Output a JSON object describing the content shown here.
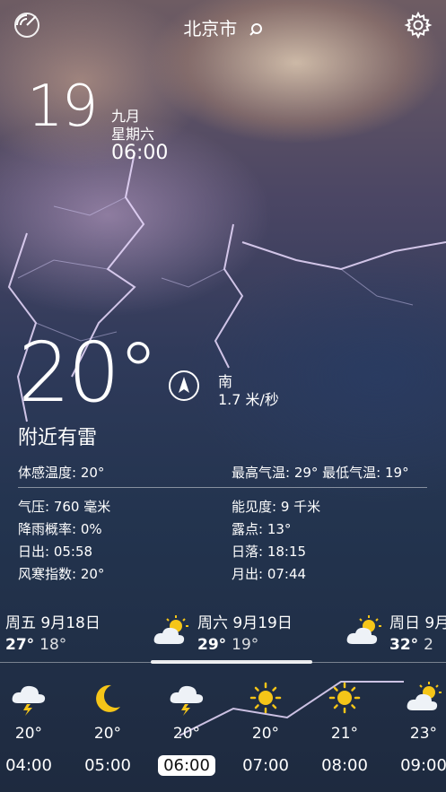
{
  "header": {
    "city": "北京市",
    "icons": {
      "left": "radar-icon",
      "search": "search-icon",
      "right": "gear-icon"
    }
  },
  "date": {
    "day": "19",
    "month": "九月",
    "weekday": "星期六",
    "time": "06:00"
  },
  "current": {
    "temperature": "20°",
    "condition": "附近有雷",
    "wind": {
      "direction": "南",
      "speed": "1.7 米/秒",
      "icon": "wind-direction-icon"
    }
  },
  "details": {
    "feels_like": "体感温度: 20°",
    "high_low": "最高气温: 29° 最低气温: 19°",
    "pressure": "气压:  760 毫米",
    "visibility": "能见度: 9 千米",
    "rain_chance": "降雨概率: 0%",
    "dew_point": "露点: 13°",
    "sunrise": "日出: 05:58",
    "sunset": "日落: 18:15",
    "wind_chill": "风寒指数: 20°",
    "moonrise": "月出: 07:44"
  },
  "daily": [
    {
      "name": "周五  9月18日",
      "high": "27°",
      "low": "18°",
      "icon": "none"
    },
    {
      "name": "周六  9月19日",
      "high": "29°",
      "low": "19°",
      "icon": "partly-cloudy-icon"
    },
    {
      "name": "周日  9月",
      "high": "32°",
      "low": "2",
      "icon": "partly-cloudy-icon"
    }
  ],
  "hourly": [
    {
      "temp": "20°",
      "time": "04:00",
      "icon": "thunder-cloud-icon",
      "selected": false
    },
    {
      "temp": "20°",
      "time": "05:00",
      "icon": "moon-icon",
      "selected": false
    },
    {
      "temp": "20°",
      "time": "06:00",
      "icon": "thunder-cloud-icon",
      "selected": true
    },
    {
      "temp": "20°",
      "time": "07:00",
      "icon": "sun-icon",
      "selected": false
    },
    {
      "temp": "21°",
      "time": "08:00",
      "icon": "sun-icon",
      "selected": false
    },
    {
      "temp": "23°",
      "time": "09:00",
      "icon": "partly-cloudy-icon",
      "selected": false
    }
  ],
  "colors": {
    "text": "#ffffff",
    "sun": "#f5c518",
    "moon": "#f5c518",
    "cloud": "#eef2f7"
  }
}
